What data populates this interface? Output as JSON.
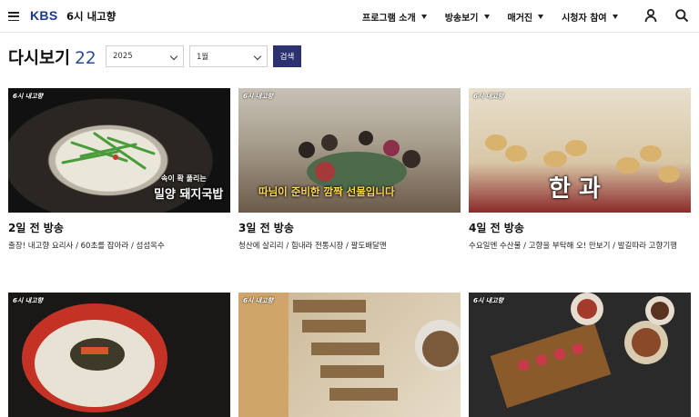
{
  "header": {
    "logo": "KBS",
    "program_name": "6시 내고향",
    "nav": [
      {
        "label": "프로그램 소개"
      },
      {
        "label": "방송보기"
      },
      {
        "label": "매거진"
      },
      {
        "label": "시청자 참여"
      }
    ],
    "icons": {
      "menu": "hamburger-icon",
      "user": "user-icon",
      "search": "search-icon"
    }
  },
  "toolbar": {
    "title": "다시보기",
    "count": "22",
    "year_value": "2025",
    "month_value": "1월",
    "search_label": "검색"
  },
  "episodes": [
    {
      "title": "2일 전 방송",
      "desc": "출장! 내고향 요리사 / 60초를 잡아라 / 섬섬옥수",
      "caption_small": "속이 확 풀리는",
      "caption": "밀양 돼지국밥"
    },
    {
      "title": "3일 전 방송",
      "desc": "청산에 살리리 / 힘내라 전통시장 / 팔도배달맨",
      "caption": "따님이 준비한 깜짝 선물입니다"
    },
    {
      "title": "4일 전 방송",
      "desc": "수요일엔 수산물 / 고향을 부탁해 오! 만보기 / 발길따라 고향기행",
      "caption": "한 과"
    },
    {
      "title": "",
      "desc": "",
      "caption": ""
    },
    {
      "title": "",
      "desc": "",
      "caption": ""
    },
    {
      "title": "",
      "desc": "",
      "caption": ""
    }
  ],
  "colors": {
    "brand": "#1a3a8c",
    "count": "#2a4a9a",
    "search_button": "#2c3170"
  }
}
